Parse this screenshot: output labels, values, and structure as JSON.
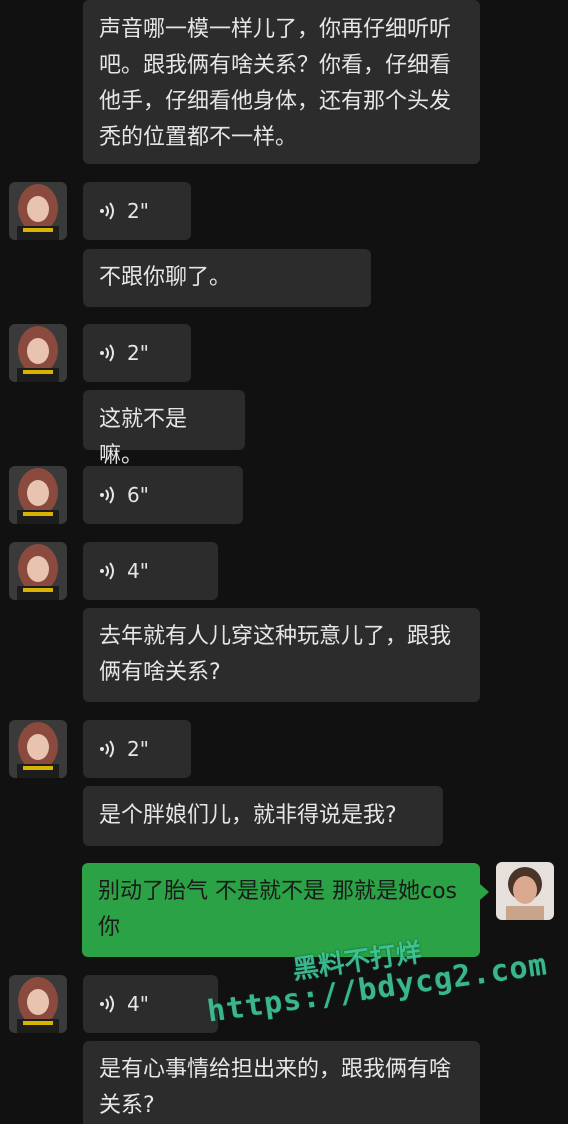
{
  "messages": [
    {
      "type": "text",
      "side": "left",
      "text": "声音哪一模一样儿了，你再仔细听听吧。跟我俩有啥关系？你看，仔细看他手，仔细看他身体，还有那个头发秃的位置都不一样。"
    },
    {
      "type": "voice",
      "side": "left",
      "duration": "2\""
    },
    {
      "type": "text",
      "side": "left",
      "text": "不跟你聊了。"
    },
    {
      "type": "voice",
      "side": "left",
      "duration": "2\""
    },
    {
      "type": "text",
      "side": "left",
      "text": "这就不是嘛。"
    },
    {
      "type": "voice",
      "side": "left",
      "duration": "6\""
    },
    {
      "type": "voice",
      "side": "left",
      "duration": "4\""
    },
    {
      "type": "text",
      "side": "left",
      "text": "去年就有人儿穿这种玩意儿了，跟我俩有啥关系?"
    },
    {
      "type": "voice",
      "side": "left",
      "duration": "2\""
    },
    {
      "type": "text",
      "side": "left",
      "text": "是个胖娘们儿，就非得说是我?"
    },
    {
      "type": "text",
      "side": "right",
      "text": "别动了胎气 不是就不是 那就是她cos 你"
    },
    {
      "type": "voice",
      "side": "left",
      "duration": "4\""
    },
    {
      "type": "text",
      "side": "left",
      "text": "是有心事情给担出来的，跟我俩有啥关系?"
    }
  ],
  "watermark": {
    "line1": "黑料不打烊",
    "line2": "https://bdycg2.com"
  },
  "colors": {
    "background": "#111111",
    "bubble_left": "#2c2c2c",
    "bubble_right": "#2ba245",
    "watermark": "#3fc79a"
  }
}
